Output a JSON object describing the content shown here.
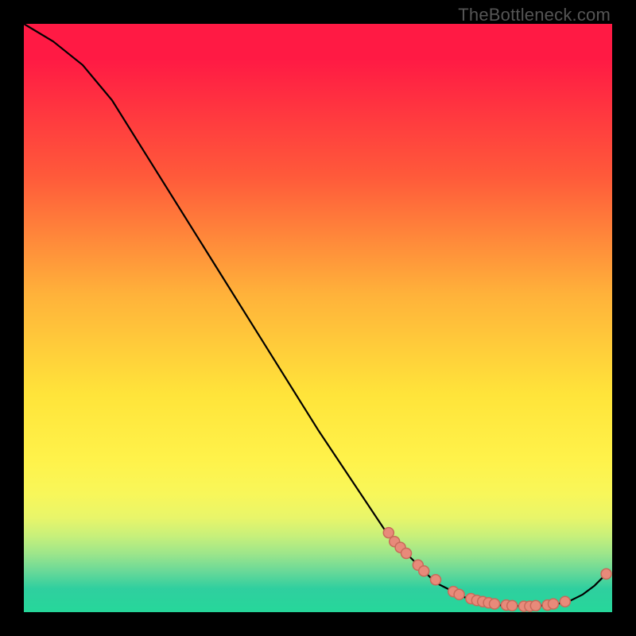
{
  "watermark": "TheBottleneck.com",
  "chart_data": {
    "type": "line",
    "title": "",
    "xlabel": "",
    "ylabel": "",
    "xlim": [
      0,
      100
    ],
    "ylim": [
      0,
      100
    ],
    "grid": false,
    "curve": [
      {
        "x": 0,
        "y": 100
      },
      {
        "x": 5,
        "y": 97
      },
      {
        "x": 10,
        "y": 93
      },
      {
        "x": 15,
        "y": 87
      },
      {
        "x": 20,
        "y": 79
      },
      {
        "x": 30,
        "y": 63
      },
      {
        "x": 40,
        "y": 47
      },
      {
        "x": 50,
        "y": 31
      },
      {
        "x": 60,
        "y": 16
      },
      {
        "x": 62,
        "y": 13
      },
      {
        "x": 66,
        "y": 9
      },
      {
        "x": 70,
        "y": 5
      },
      {
        "x": 75,
        "y": 2.5
      },
      {
        "x": 80,
        "y": 1.2
      },
      {
        "x": 85,
        "y": 1.0
      },
      {
        "x": 90,
        "y": 1.2
      },
      {
        "x": 93,
        "y": 2.0
      },
      {
        "x": 95,
        "y": 3.0
      },
      {
        "x": 97,
        "y": 4.5
      },
      {
        "x": 99,
        "y": 6.5
      }
    ],
    "dots": [
      {
        "x": 62,
        "y": 13.5
      },
      {
        "x": 63,
        "y": 12.0
      },
      {
        "x": 64,
        "y": 11.0
      },
      {
        "x": 65,
        "y": 10.0
      },
      {
        "x": 67,
        "y": 8.0
      },
      {
        "x": 68,
        "y": 7.0
      },
      {
        "x": 70,
        "y": 5.5
      },
      {
        "x": 73,
        "y": 3.5
      },
      {
        "x": 74,
        "y": 3.0
      },
      {
        "x": 76,
        "y": 2.3
      },
      {
        "x": 77,
        "y": 2.0
      },
      {
        "x": 78,
        "y": 1.8
      },
      {
        "x": 79,
        "y": 1.6
      },
      {
        "x": 80,
        "y": 1.4
      },
      {
        "x": 82,
        "y": 1.2
      },
      {
        "x": 83,
        "y": 1.1
      },
      {
        "x": 85,
        "y": 1.0
      },
      {
        "x": 86,
        "y": 1.0
      },
      {
        "x": 87,
        "y": 1.1
      },
      {
        "x": 89,
        "y": 1.2
      },
      {
        "x": 90,
        "y": 1.4
      },
      {
        "x": 92,
        "y": 1.8
      },
      {
        "x": 99,
        "y": 6.5
      }
    ],
    "dot_color": "#e88a7a"
  }
}
